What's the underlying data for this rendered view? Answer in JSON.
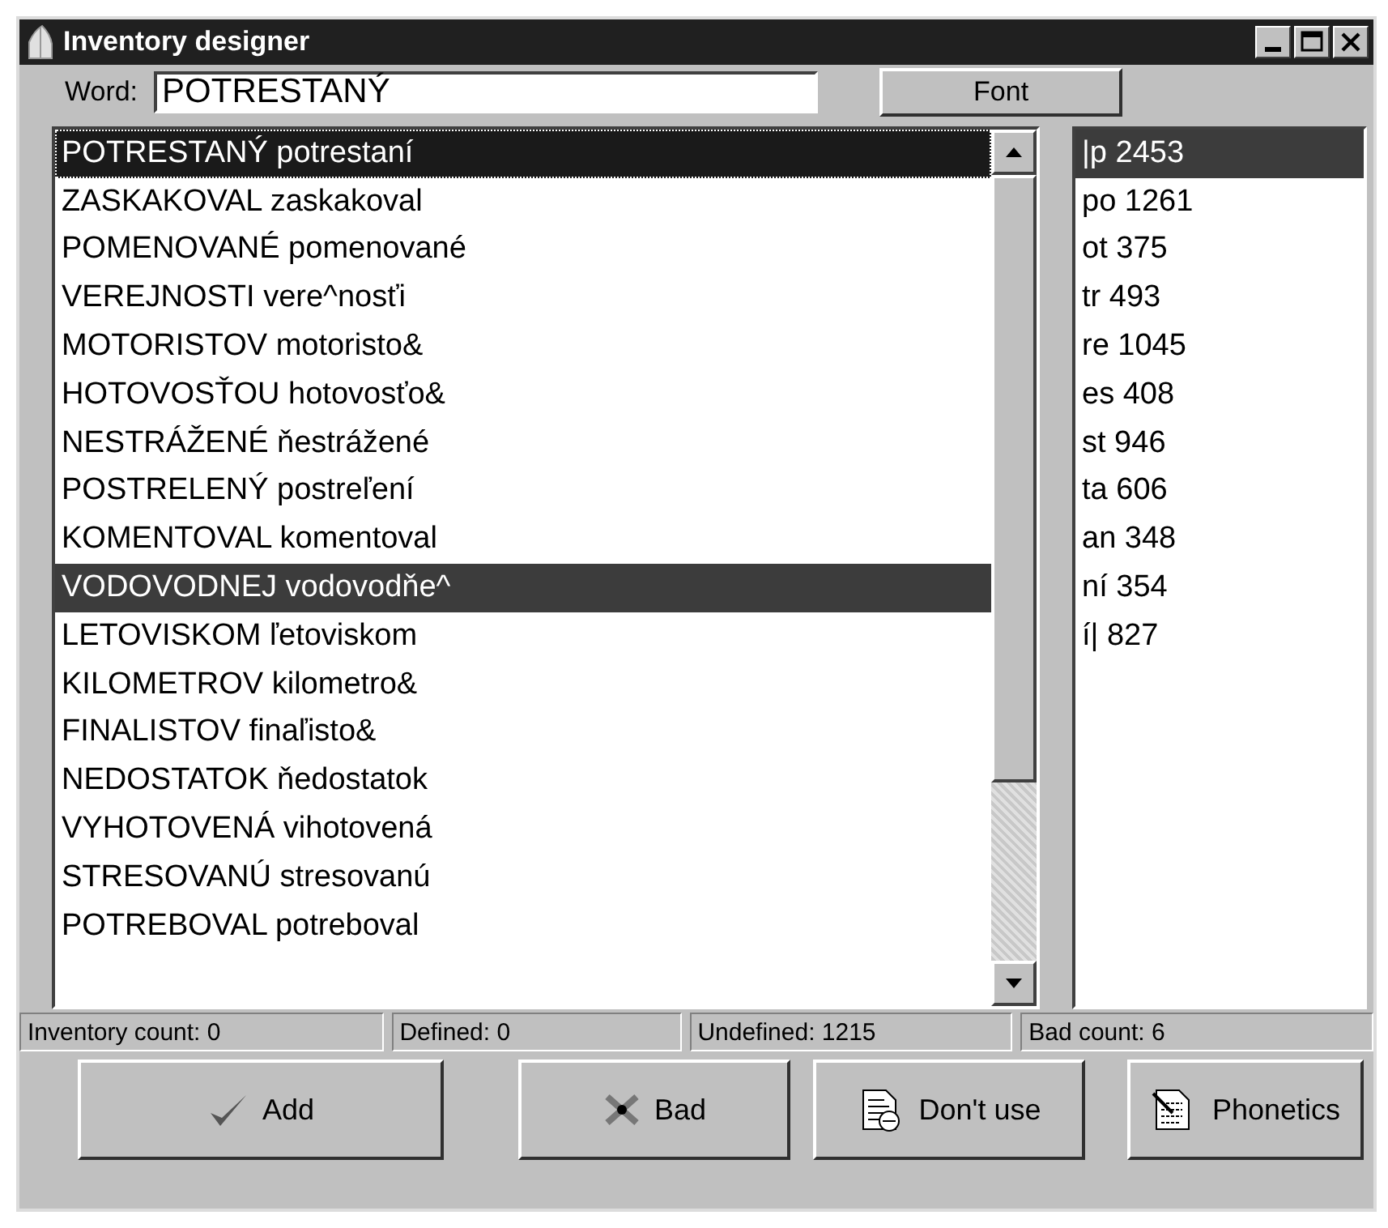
{
  "window": {
    "title": "Inventory designer"
  },
  "word": {
    "label": "Word:",
    "value": "POTRESTANÝ"
  },
  "font_button": "Font",
  "words": [
    {
      "text": "POTRESTANÝ potrestaní",
      "selected": true,
      "focused": true
    },
    {
      "text": "ZASKAKOVAL zaskakoval",
      "selected": false,
      "focused": false
    },
    {
      "text": "POMENOVANÉ pomenované",
      "selected": false,
      "focused": false
    },
    {
      "text": "VEREJNOSTI vere^nosťi",
      "selected": false,
      "focused": false
    },
    {
      "text": "MOTORISTOV motoristo&",
      "selected": false,
      "focused": false
    },
    {
      "text": "HOTOVOSŤOU hotovosťo&",
      "selected": false,
      "focused": false
    },
    {
      "text": "NESTRÁŽENÉ ňestrážené",
      "selected": false,
      "focused": false
    },
    {
      "text": "POSTRELENÝ postreľení",
      "selected": false,
      "focused": false
    },
    {
      "text": "KOMENTOVAL komentoval",
      "selected": false,
      "focused": false
    },
    {
      "text": "VODOVODNEJ vodovodňe^",
      "selected": true,
      "focused": false
    },
    {
      "text": "LETOVISKOM ľetoviskom",
      "selected": false,
      "focused": false
    },
    {
      "text": "KILOMETROV kilometro&",
      "selected": false,
      "focused": false
    },
    {
      "text": "FINALISTOV finaľisto&",
      "selected": false,
      "focused": false
    },
    {
      "text": "NEDOSTATOK ňedostatok",
      "selected": false,
      "focused": false
    },
    {
      "text": "VYHOTOVENÁ vihotovená",
      "selected": false,
      "focused": false
    },
    {
      "text": "STRESOVANÚ stresovanú",
      "selected": false,
      "focused": false
    },
    {
      "text": "POTREBOVAL potreboval",
      "selected": false,
      "focused": false
    }
  ],
  "phonemes": [
    {
      "text": "|p  2453",
      "selected": true
    },
    {
      "text": "po  1261",
      "selected": false
    },
    {
      "text": "ot  375",
      "selected": false
    },
    {
      "text": "tr  493",
      "selected": false
    },
    {
      "text": "re  1045",
      "selected": false
    },
    {
      "text": "es  408",
      "selected": false
    },
    {
      "text": "st  946",
      "selected": false
    },
    {
      "text": "ta  606",
      "selected": false
    },
    {
      "text": "an  348",
      "selected": false
    },
    {
      "text": "ní  354",
      "selected": false
    },
    {
      "text": "í|  827",
      "selected": false
    }
  ],
  "status_bar": [
    "Inventory count: 0",
    "Defined: 0",
    "Undefined: 1215",
    "Bad count: 6"
  ],
  "buttons": [
    {
      "kind": "check",
      "label": "Add"
    },
    {
      "kind": "cross",
      "label": "Bad"
    },
    {
      "kind": "doc",
      "label": "Don't use"
    },
    {
      "kind": "pen",
      "label": "Phonetics"
    }
  ]
}
